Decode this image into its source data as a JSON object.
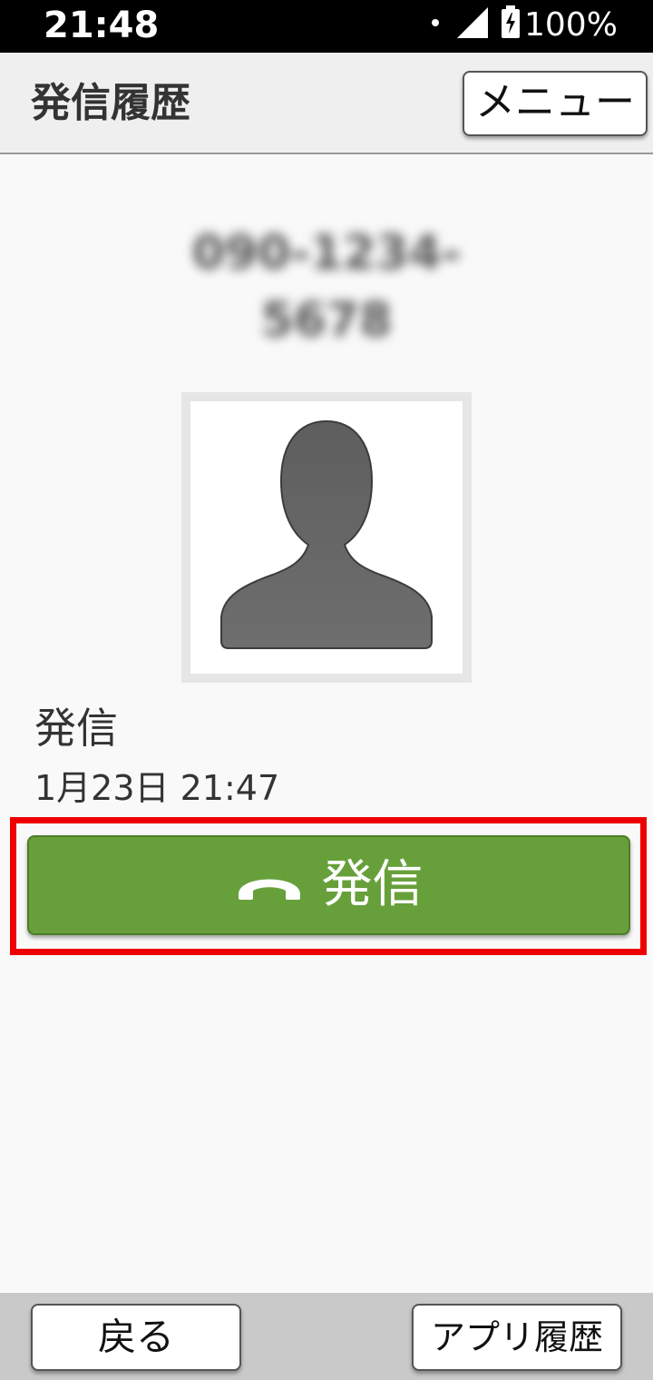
{
  "status_bar": {
    "time": "21:48",
    "battery": "100%",
    "icons": [
      "notification-dot-icon",
      "signal-icon",
      "battery-charging-icon"
    ]
  },
  "header": {
    "title": "発信履歴",
    "menu_label": "メニュー"
  },
  "contact": {
    "number": "090-1234-5678",
    "number_blurred": true,
    "avatar_icon": "person-silhouette-icon"
  },
  "call": {
    "type": "発信",
    "datetime": "1月23日 21:47"
  },
  "call_button": {
    "label": "発信",
    "icon": "phone-handset-icon",
    "color": "#67a03a",
    "highlight_color": "#ee0000"
  },
  "bottom_bar": {
    "back_label": "戻る",
    "recent_apps_label": "アプリ履歴"
  }
}
